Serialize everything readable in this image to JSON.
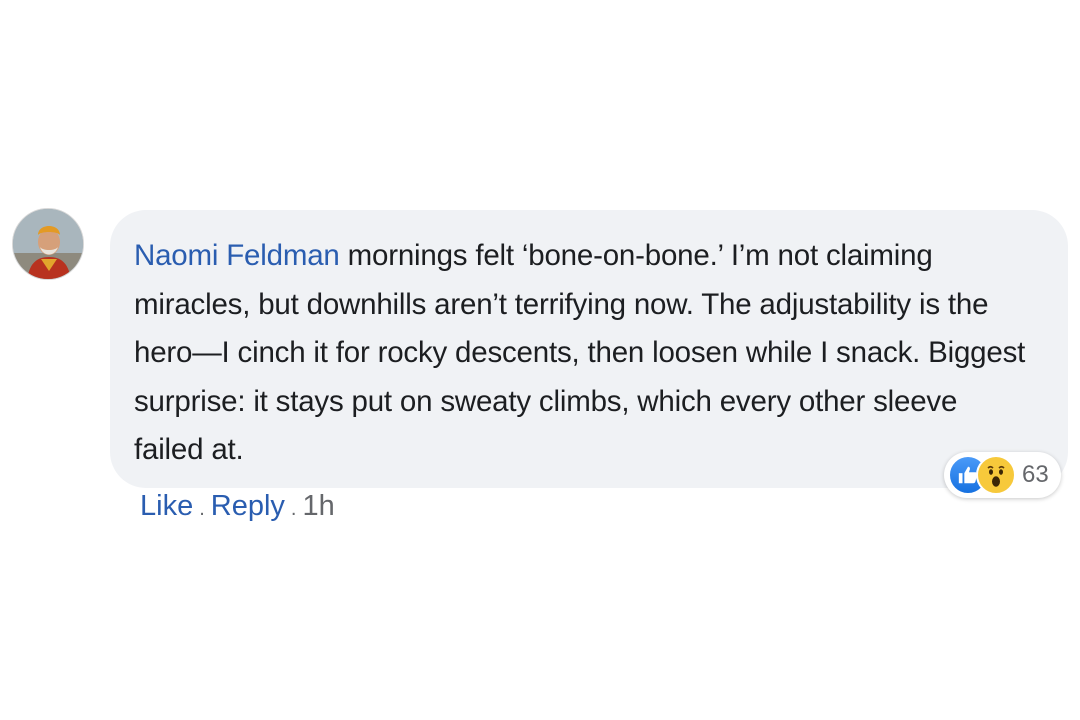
{
  "comment": {
    "author": "Naomi Feldman",
    "text": "mornings felt ‘bone-on-bone.’ I’m not claiming miracles, but downhills aren’t terrifying now. The adjustability is the hero—I cinch it for rocky descents, then loosen while I snack. Biggest surprise: it stays put on sweaty climbs, which every other sleeve failed at."
  },
  "reactions": {
    "icons": [
      "like-icon",
      "wow-icon"
    ],
    "count": "63"
  },
  "actions": {
    "like_label": "Like",
    "separator": ".",
    "reply_label": "Reply",
    "timestamp": "1h"
  },
  "colors": {
    "author_link": "#2a5db0",
    "bubble_bg": "#f0f2f5",
    "like_blue": "#1877f2",
    "wow_yellow": "#f7c93b"
  }
}
